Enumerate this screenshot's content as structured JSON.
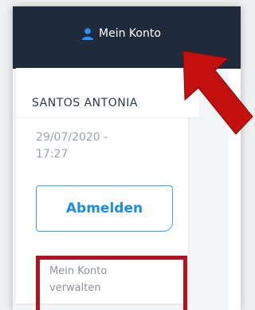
{
  "header": {
    "account_label": "Mein Konto",
    "account_icon": "user-icon"
  },
  "panel": {
    "user_name": "SANTOS ANTONIA",
    "timestamp": "29/07/2020 -\n17:27",
    "logout_label": "Abmelden",
    "manage_label": "Mein Konto\nverwalten"
  },
  "colors": {
    "header_bg": "#1f2a3b",
    "accent": "#1a8cf0",
    "highlight": "#b3121e"
  }
}
